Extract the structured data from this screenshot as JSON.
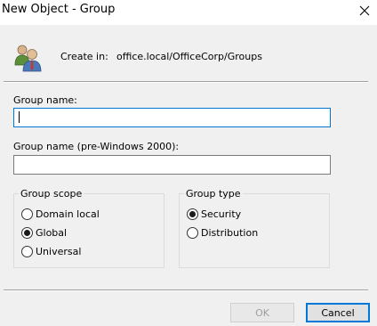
{
  "window": {
    "title": "New Object - Group",
    "close_glyph": "✕"
  },
  "header": {
    "icon": "users-group-icon",
    "create_in_label": "Create in:",
    "create_in_value": "office.local/OfficeCorp/Groups"
  },
  "form": {
    "group_name_label": "Group name:",
    "group_name_value": "",
    "pre2000_label": "Group name (pre-Windows 2000):",
    "pre2000_value": ""
  },
  "group_scope": {
    "legend": "Group scope",
    "options": [
      "Domain local",
      "Global",
      "Universal"
    ],
    "selected": "Global"
  },
  "group_type": {
    "legend": "Group type",
    "options": [
      "Security",
      "Distribution"
    ],
    "selected": "Security"
  },
  "buttons": {
    "ok_label": "OK",
    "ok_enabled": false,
    "cancel_label": "Cancel"
  },
  "colors": {
    "focus_accent": "#0078d7",
    "dialog_bg": "#f0f0f0"
  }
}
